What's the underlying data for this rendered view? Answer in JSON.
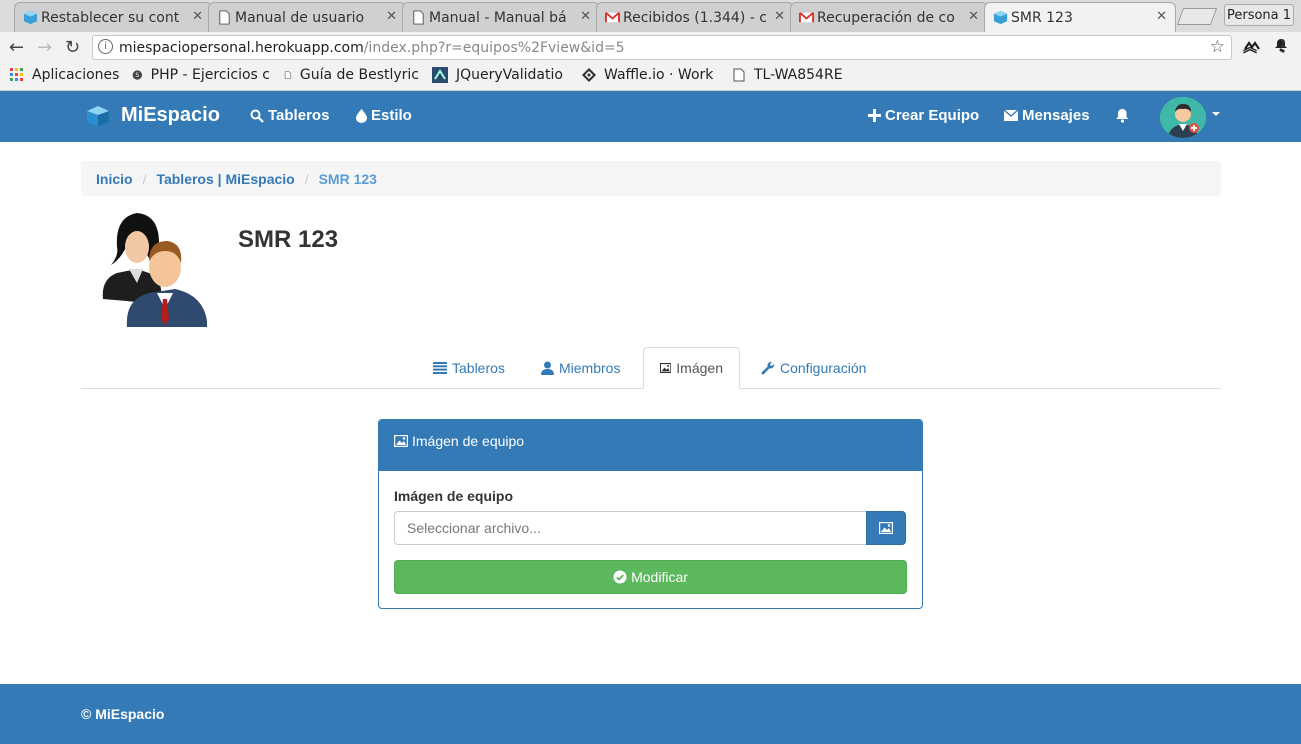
{
  "browser": {
    "tabs": [
      {
        "title": "Restablecer su cont",
        "active": false
      },
      {
        "title": "Manual de usuario",
        "active": false
      },
      {
        "title": "Manual - Manual bá",
        "active": false
      },
      {
        "title": "Recibidos (1.344) - c",
        "active": false
      },
      {
        "title": "Recuperación de co",
        "active": false
      },
      {
        "title": "SMR 123",
        "active": true
      }
    ],
    "profile": "Persona 1",
    "url_host": "miespaciopersonal.herokuapp.com",
    "url_path": "/index.php?r=equipos%2Fview&id=5",
    "bookmarks": [
      "Aplicaciones",
      "PHP - Ejercicios c",
      "Guía de Bestlyric",
      "JQueryValidatio",
      "Waffle.io · Work",
      "TL-WA854RE"
    ]
  },
  "navbar": {
    "brand": "MiEspacio",
    "tableros": "Tableros",
    "estilo": "Estilo",
    "crear_equipo": "Crear Equipo",
    "mensajes": "Mensajes"
  },
  "breadcrumb": {
    "inicio": "Inicio",
    "tableros": "Tableros | MiEspacio",
    "current": "SMR 123"
  },
  "team": {
    "name": "SMR 123"
  },
  "tabs": {
    "tableros": "Tableros",
    "miembros": "Miembros",
    "imagen": "Imágen",
    "configuracion": "Configuración"
  },
  "panel": {
    "heading": "Imágen de equipo",
    "field_label": "Imágen de equipo",
    "file_placeholder": "Seleccionar archivo...",
    "submit": "Modificar"
  },
  "footer": {
    "copyright": "© MiEspacio"
  },
  "colors": {
    "primary": "#337ab7",
    "success": "#5cb85c"
  }
}
